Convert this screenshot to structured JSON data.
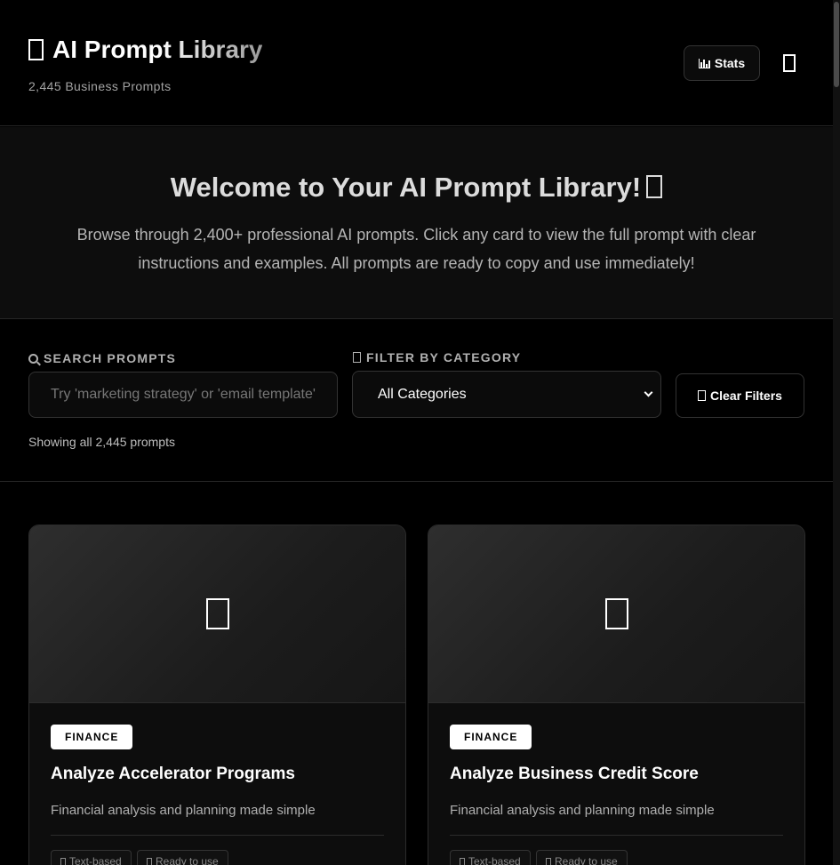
{
  "header": {
    "title": "AI Prompt Library",
    "title_icon": "library-icon",
    "subtitle": "2,445 Business Prompts",
    "stats_label": "Stats",
    "stats_icon": "bar-chart-icon",
    "theme_icon": "theme-toggle-icon"
  },
  "welcome": {
    "heading": "Welcome to Your AI Prompt Library!",
    "heading_icon": "sparkle-icon",
    "body": "Browse through 2,400+ professional AI prompts. Click any card to view the full prompt with clear instructions and examples. All prompts are ready to copy and use immediately!"
  },
  "filters": {
    "search_label": "SEARCH PROMPTS",
    "search_icon": "search-icon",
    "search_placeholder": "Try 'marketing strategy' or 'email template'",
    "search_value": "",
    "category_label": "FILTER BY CATEGORY",
    "category_icon": "folder-icon",
    "category_selected": "All Categories",
    "clear_label": "Clear Filters",
    "clear_icon": "clear-icon",
    "result_count": "Showing all 2,445 prompts"
  },
  "cards": [
    {
      "category": "FINANCE",
      "title": "Analyze Accelerator Programs",
      "description": "Financial analysis and planning made simple",
      "media_icon": "finance-icon",
      "tags": [
        {
          "label": "Text-based",
          "icon": "document-icon"
        },
        {
          "label": "Ready to use",
          "icon": "check-icon"
        }
      ]
    },
    {
      "category": "FINANCE",
      "title": "Analyze Business Credit Score",
      "description": "Financial analysis and planning made simple",
      "media_icon": "finance-icon",
      "tags": [
        {
          "label": "Text-based",
          "icon": "document-icon"
        },
        {
          "label": "Ready to use",
          "icon": "check-icon"
        }
      ]
    }
  ],
  "colors": {
    "background": "#000000",
    "surface": "#0d0d0d",
    "border": "#2c2c2c",
    "badge_bg": "#ffffff",
    "badge_text": "#000000"
  }
}
